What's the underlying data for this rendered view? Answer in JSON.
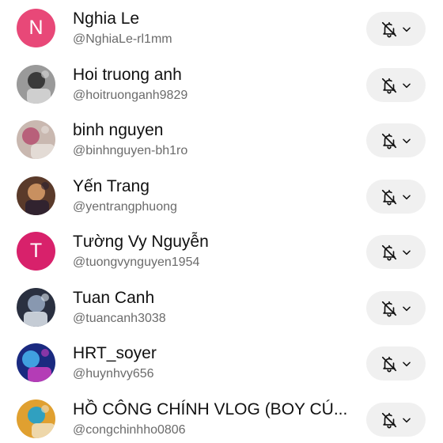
{
  "subscriptions": [
    {
      "name": "Nghia Le",
      "handle": "@NghiaLe-rl1mm",
      "avatar": {
        "type": "initial",
        "letter": "N",
        "color": "#e84878"
      }
    },
    {
      "name": "Hoi truong anh",
      "handle": "@hoitruonganh9829",
      "avatar": {
        "type": "photo",
        "palette": [
          "#9a9a9a",
          "#3a3a3a",
          "#d8d8d8"
        ]
      }
    },
    {
      "name": "binh nguyen",
      "handle": "@binhnguyen-bh1ro",
      "avatar": {
        "type": "photo",
        "palette": [
          "#c9b8b0",
          "#b8607a",
          "#e8e0dc"
        ]
      }
    },
    {
      "name": "Yến Trang",
      "handle": "@yentrangphuong",
      "avatar": {
        "type": "photo",
        "palette": [
          "#5a3a2a",
          "#c89060",
          "#2a2030"
        ]
      }
    },
    {
      "name": "Tường Vy Nguyễn",
      "handle": "@tuongvynguyen1954",
      "avatar": {
        "type": "initial",
        "letter": "T",
        "color": "#d8216b"
      }
    },
    {
      "name": "Tuan Canh",
      "handle": "@tuancanh3038",
      "avatar": {
        "type": "photo",
        "palette": [
          "#2a3040",
          "#8898b0",
          "#e0e8f0"
        ]
      }
    },
    {
      "name": "HRT_soyer",
      "handle": "@huynhvy656",
      "avatar": {
        "type": "photo",
        "palette": [
          "#1a2a80",
          "#40a0e0",
          "#d040c0"
        ]
      }
    },
    {
      "name": "HỒ CÔNG CHÍNH VLOG (BOY CÚ...",
      "handle": "@congchinhho0806",
      "avatar": {
        "type": "photo",
        "palette": [
          "#e0a030",
          "#30a0c0",
          "#f0e0c0"
        ]
      }
    }
  ],
  "notify_button": {
    "icon": "bell-off-icon",
    "dropdown_icon": "chevron-down-icon"
  },
  "colors": {
    "text": "#111111",
    "secondary_text": "#6b6b6b",
    "button_bg": "#f0f0f0"
  }
}
